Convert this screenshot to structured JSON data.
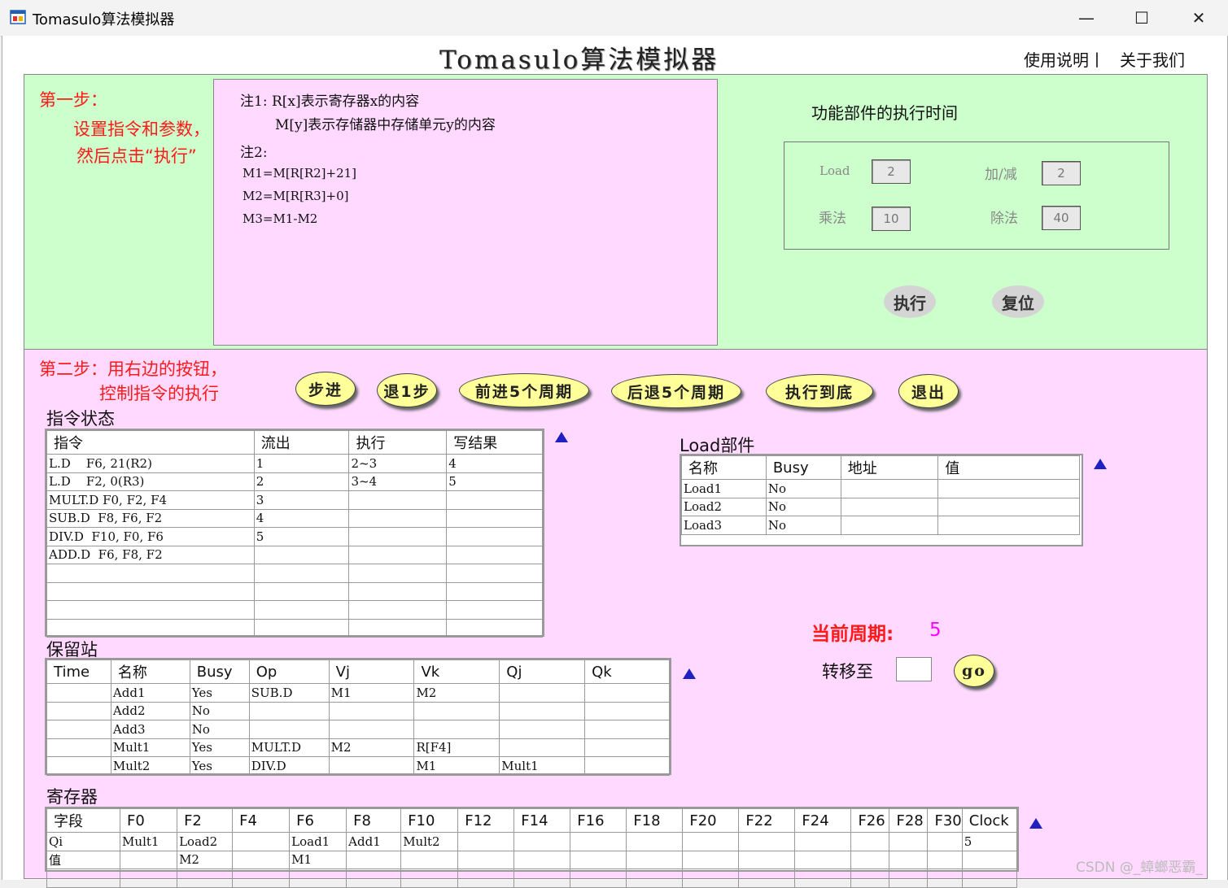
{
  "window": {
    "title": "Tomasulo算法模拟器",
    "minimize": "—",
    "maximize": "☐",
    "close": "✕"
  },
  "header": {
    "title": "Tomasulo算法模拟器",
    "help_link": "使用说明丨",
    "about_link": "关于我们"
  },
  "step1": {
    "title": "第一步：",
    "desc_line1": "设置指令和参数，",
    "desc_line2": "然后点击“执行”",
    "notes": {
      "line1": "注1: R[x]表示寄存器x的内容",
      "line2": "M[y]表示存储器中存储单元y的内容",
      "line3": "注2:",
      "line4": "M1=M[R[R2]+21]",
      "line5": "M2=M[R[R3]+0]",
      "line6": "M3=M1-M2"
    },
    "fu_title": "功能部件的执行时间",
    "fu": {
      "load_label": "Load",
      "load_value": "2",
      "addsub_label": "加/减",
      "addsub_value": "2",
      "mul_label": "乘法",
      "mul_value": "10",
      "div_label": "除法",
      "div_value": "40"
    },
    "execute_button": "执行",
    "reset_button": "复位"
  },
  "step2": {
    "title": "第二步：用右边的按钮，",
    "desc": "控制指令的执行",
    "buttons": {
      "step": "步进",
      "back1": "退1步",
      "fwd5": "前进5个周期",
      "back5": "后退5个周期",
      "run_end": "执行到底",
      "exit": "退出"
    }
  },
  "instruction_status": {
    "label": "指令状态",
    "headers": [
      "指令",
      "流出",
      "执行",
      "写结果"
    ],
    "rows": [
      [
        "L.D    F6, 21(R2)",
        "1",
        "2~3",
        "4"
      ],
      [
        "L.D    F2, 0(R3)",
        "2",
        "3~4",
        "5"
      ],
      [
        "MULT.D F0, F2, F4",
        "3",
        "",
        ""
      ],
      [
        "SUB.D  F8, F6, F2",
        "4",
        "",
        ""
      ],
      [
        "DIV.D  F10, F0, F6",
        "5",
        "",
        ""
      ],
      [
        "ADD.D  F6, F8, F2",
        "",
        "",
        ""
      ],
      [
        "",
        "",
        "",
        ""
      ],
      [
        "",
        "",
        "",
        ""
      ],
      [
        "",
        "",
        "",
        ""
      ],
      [
        "",
        "",
        "",
        ""
      ]
    ]
  },
  "load_unit": {
    "label": "Load部件",
    "headers": [
      "名称",
      "Busy",
      "地址",
      "值"
    ],
    "rows": [
      [
        "Load1",
        "No",
        "",
        ""
      ],
      [
        "Load2",
        "No",
        "",
        ""
      ],
      [
        "Load3",
        "No",
        "",
        ""
      ]
    ]
  },
  "reservation_stations": {
    "label": "保留站",
    "headers": [
      "Time",
      "名称",
      "Busy",
      "Op",
      "Vj",
      "Vk",
      "Qj",
      "Qk"
    ],
    "rows": [
      [
        "",
        "Add1",
        "Yes",
        "SUB.D",
        "M1",
        "M2",
        "",
        ""
      ],
      [
        "",
        "Add2",
        "No",
        "",
        "",
        "",
        "",
        ""
      ],
      [
        "",
        "Add3",
        "No",
        "",
        "",
        "",
        "",
        ""
      ],
      [
        "",
        "Mult1",
        "Yes",
        "MULT.D",
        "M2",
        "R[F4]",
        "",
        ""
      ],
      [
        "",
        "Mult2",
        "Yes",
        "DIV.D",
        "",
        "M1",
        "Mult1",
        ""
      ]
    ]
  },
  "registers": {
    "label": "寄存器",
    "headers": [
      "字段",
      "F0",
      "F2",
      "F4",
      "F6",
      "F8",
      "F10",
      "F12",
      "F14",
      "F16",
      "F18",
      "F20",
      "F22",
      "F24",
      "F26",
      "F28",
      "F30",
      "Clock"
    ],
    "rows": [
      [
        "Qi",
        "Mult1",
        "Load2",
        "",
        "Load1",
        "Add1",
        "Mult2",
        "",
        "",
        "",
        "",
        "",
        "",
        "",
        "",
        "",
        "",
        "5"
      ],
      [
        "值",
        "",
        "M2",
        "",
        "M1",
        "",
        "",
        "",
        "",
        "",
        "",
        "",
        "",
        "",
        "",
        "",
        "",
        ""
      ],
      [
        "",
        "",
        "",
        "",
        "",
        "",
        "",
        "",
        "",
        "",
        "",
        "",
        "",
        "",
        "",
        "",
        "",
        ""
      ]
    ]
  },
  "cycle": {
    "label": "当前周期:",
    "value": "5",
    "goto_label": "转移至",
    "goto_value": "",
    "go_button": "go"
  },
  "watermark": "CSDN @_蟑螂恶霸_",
  "colors": {
    "green_panel": "#ccffcc",
    "pink_panel": "#ffd9ff",
    "button_yellow": "#ffff99",
    "accent_red": "#ff1a1a",
    "cycle_magenta": "#ff00ff",
    "triangle_blue": "#2020c0"
  },
  "icons": {
    "app": "app-window-icon",
    "scroll": "scroll-up-triangle-icon"
  }
}
